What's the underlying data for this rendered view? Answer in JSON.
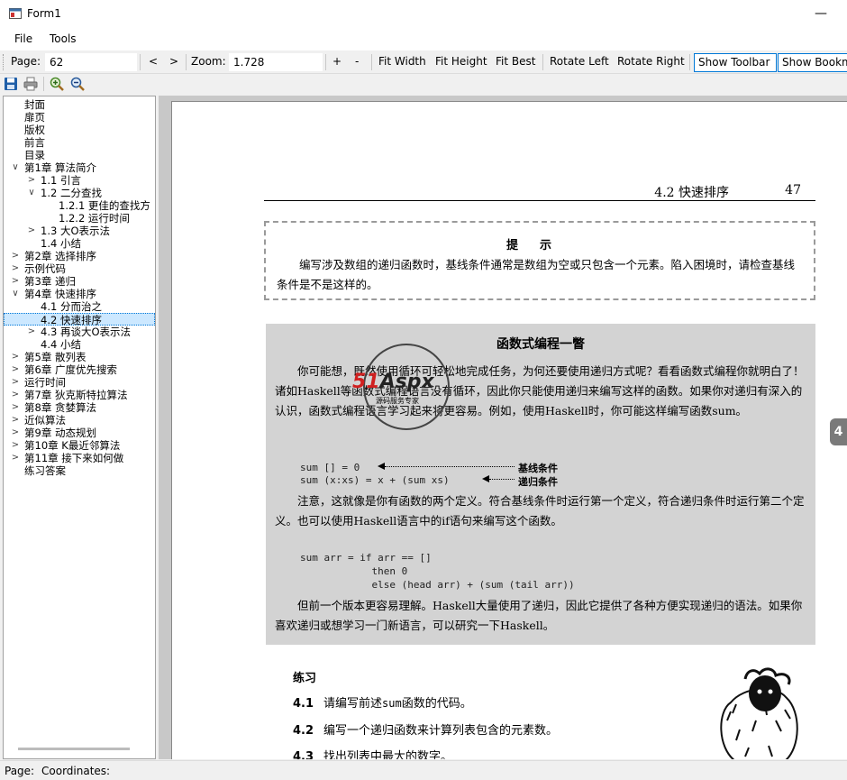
{
  "window": {
    "title": "Form1",
    "minimize": "—"
  },
  "menu": {
    "file": "File",
    "tools": "Tools"
  },
  "toolbar": {
    "page_label": "Page:",
    "page_value": "62",
    "prev": "<",
    "next": ">",
    "zoom_label": "Zoom:",
    "zoom_value": "1.728",
    "zoom_in": "+",
    "zoom_out": "-",
    "fit_width": "Fit Width",
    "fit_height": "Fit Height",
    "fit_best": "Fit Best",
    "rotate_left": "Rotate Left",
    "rotate_right": "Rotate Right",
    "show_toolbar": "Show Toolbar",
    "show_bookmarks": "Show Bookm"
  },
  "icons": {
    "save": "save-icon",
    "print": "print-icon",
    "zoom_in": "zoom-in-icon",
    "zoom_out": "zoom-out-icon"
  },
  "tree": {
    "items": [
      {
        "label": "封面",
        "expander": ""
      },
      {
        "label": "扉页",
        "expander": ""
      },
      {
        "label": "版权",
        "expander": ""
      },
      {
        "label": "前言",
        "expander": ""
      },
      {
        "label": "目录",
        "expander": ""
      },
      {
        "label": "第1章 算法简介",
        "expander": "∨"
      },
      {
        "label": "1.1 引言",
        "expander": ">"
      },
      {
        "label": "1.2 二分查找",
        "expander": "∨"
      },
      {
        "label": "1.2.1 更佳的查找方",
        "expander": ""
      },
      {
        "label": "1.2.2 运行时间",
        "expander": ""
      },
      {
        "label": "1.3 大O表示法",
        "expander": ">"
      },
      {
        "label": "1.4 小结",
        "expander": ""
      },
      {
        "label": "第2章 选择排序",
        "expander": ">"
      },
      {
        "label": "示例代码",
        "expander": ">"
      },
      {
        "label": "第3章 递归",
        "expander": ">"
      },
      {
        "label": "第4章 快速排序",
        "expander": "∨"
      },
      {
        "label": "4.1 分而治之",
        "expander": ""
      },
      {
        "label": "4.2 快速排序",
        "expander": ""
      },
      {
        "label": "4.3 再谈大O表示法",
        "expander": ">"
      },
      {
        "label": "4.4 小结",
        "expander": ""
      },
      {
        "label": "第5章 散列表",
        "expander": ">"
      },
      {
        "label": "第6章 广度优先搜索",
        "expander": ">"
      },
      {
        "label": "运行时间",
        "expander": ">"
      },
      {
        "label": "第7章 狄克斯特拉算法",
        "expander": ">"
      },
      {
        "label": "第8章 贪婪算法",
        "expander": ">"
      },
      {
        "label": "近似算法",
        "expander": ">"
      },
      {
        "label": "第9章 动态规划",
        "expander": ">"
      },
      {
        "label": "第10章 K最近邻算法",
        "expander": ">"
      },
      {
        "label": "第11章 接下来如何做",
        "expander": ">"
      },
      {
        "label": "练习答案",
        "expander": ""
      }
    ]
  },
  "document": {
    "running_head_section": "4.2  快速排序",
    "running_head_page": "47",
    "tip_title": "提示",
    "tip_text": "编写涉及数组的递归函数时，基线条件通常是数组为空或只包含一个元素。陷入困境时，请检查基线条件是不是这样的。",
    "fp_title": "函数式编程一瞥",
    "fp_p1": "你可能想，既然使用循环可轻松地完成任务，为何还要使用递归方式呢？看看函数式编程你就明白了！诸如Haskell等函数式编程语言没有循环，因此你只能使用递归来编写这样的函数。如果你对递归有深入的认识，函数式编程语言学习起来将更容易。例如，使用Haskell时，你可能这样编写函数sum。",
    "code1_line1": "sum [] = 0",
    "code1_line2": "sum (x:xs) = x + (sum xs)",
    "ann_base": "基线条件",
    "ann_recursive": "递归条件",
    "fp_p2": "注意，这就像是你有函数的两个定义。符合基线条件时运行第一个定义，符合递归条件时运行第二个定义。也可以使用Haskell语言中的if语句来编写这个函数。",
    "code2": "sum arr = if arr == []\n            then 0\n            else (head arr) + (sum (tail arr))",
    "fp_p3": "但前一个版本更容易理解。Haskell大量使用了递归，因此它提供了各种方便实现递归的语法。如果你喜欢递归或想学习一门新语言，可以研究一下Haskell。",
    "watermark_logo_a": "51",
    "watermark_logo_b": "Aspx",
    "watermark_sub": "源码服务专家",
    "exercise_title": "练习",
    "exercises": [
      {
        "num": "4.1",
        "text_a": "请编写前述",
        "code": "sum",
        "text_b": "函数的代码。"
      },
      {
        "num": "4.2",
        "text_a": "编写一个递归函数来计算列表包含的元素数。",
        "code": "",
        "text_b": ""
      },
      {
        "num": "4.3",
        "text_a": "找出列表中最大的数字。",
        "code": "",
        "text_b": ""
      }
    ]
  },
  "side_tab": "4",
  "status": {
    "page": "Page:",
    "coordinates": "Coordinates:"
  }
}
